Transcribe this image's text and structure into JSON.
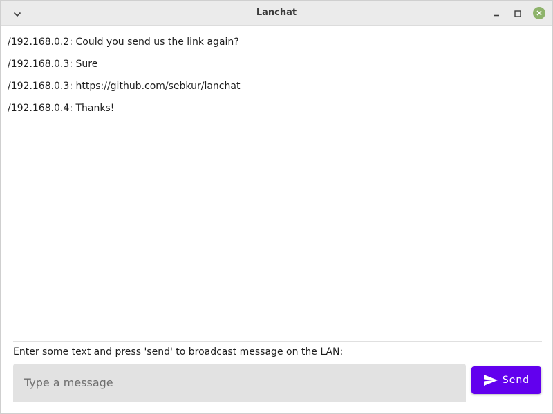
{
  "window": {
    "title": "Lanchat"
  },
  "titlebar": {
    "menu_icon": "chevron-down-icon",
    "minimize_icon": "minimize-icon",
    "maximize_icon": "maximize-icon",
    "close_icon": "close-icon"
  },
  "messages": [
    {
      "text": "/192.168.0.2: Could you send us the link again?"
    },
    {
      "text": "/192.168.0.3: Sure"
    },
    {
      "text": "/192.168.0.3: https://github.com/sebkur/lanchat"
    },
    {
      "text": "/192.168.0.4: Thanks!"
    }
  ],
  "composer": {
    "prompt": "Enter some text and press 'send' to broadcast message on the LAN:",
    "input_value": "",
    "input_placeholder": "Type a message",
    "send_label": "Send",
    "send_icon": "send-icon"
  },
  "colors": {
    "accent": "#6200ee",
    "close_button": "#8eb36b"
  }
}
